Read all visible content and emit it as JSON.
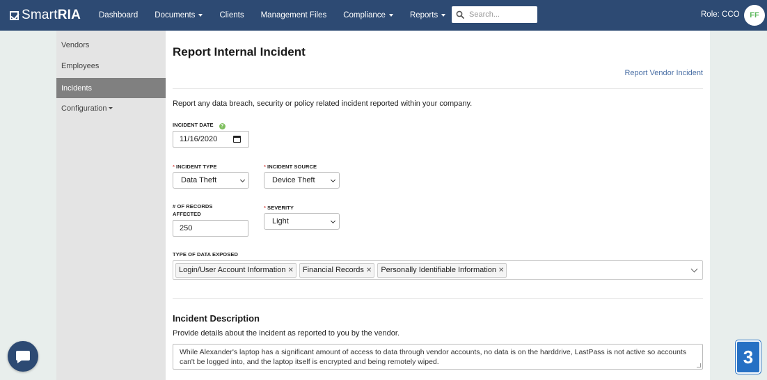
{
  "app": {
    "logo_text_light": "Smart",
    "logo_text_bold": "RIA"
  },
  "nav": {
    "items": [
      {
        "label": "Dashboard",
        "dropdown": false
      },
      {
        "label": "Documents",
        "dropdown": true
      },
      {
        "label": "Clients",
        "dropdown": false
      },
      {
        "label": "Management Files",
        "dropdown": false
      },
      {
        "label": "Compliance",
        "dropdown": true
      },
      {
        "label": "Reports",
        "dropdown": true
      }
    ],
    "search_placeholder": "Search...",
    "role": "Role: CCO",
    "avatar_initials": "FF"
  },
  "sidebar": {
    "items": [
      {
        "label": "Vendors"
      },
      {
        "label": "Employees"
      },
      {
        "label": "Incidents",
        "active": true
      },
      {
        "label": "Configuration",
        "dropdown": true
      }
    ]
  },
  "page": {
    "title": "Report Internal Incident",
    "vendor_link": "Report Vendor Incident",
    "intro": "Report any data breach, security or policy related incident reported within your company."
  },
  "form": {
    "incident_date": {
      "label": "Incident Date",
      "value": "11/16/2020"
    },
    "incident_type": {
      "label": "Incident Type",
      "value": "Data Theft",
      "required": true
    },
    "incident_source": {
      "label": "Incident Source",
      "value": "Device Theft",
      "required": true
    },
    "records_affected": {
      "label_line1": "# of Records",
      "label_line2": "Affected",
      "value": "250"
    },
    "severity": {
      "label": "Severity",
      "value": "Light",
      "required": true
    },
    "data_exposed": {
      "label": "Type of Data Exposed",
      "tags": [
        "Login/User Account Information",
        "Financial Records",
        "Personally Identifiable Information"
      ]
    },
    "description": {
      "heading": "Incident Description",
      "help": "Provide details about the incident as reported to you by the vendor.",
      "value": "While Alexander's laptop has a significant amount of access to data through vendor accounts, no data is on the harddrive, LastPass is not active so accounts can't be logged into, and the laptop itself is encrypted and being remotely wiped."
    }
  },
  "floating": {
    "badge_number": "3"
  },
  "colors": {
    "nav_bg": "#2d4a73",
    "sidebar_active": "#808080",
    "link": "#4a6fa5",
    "required": "#d9534f",
    "badge": "#2670c4"
  },
  "icons": [
    "check-logo-icon",
    "search-icon",
    "help-icon",
    "calendar-icon",
    "chevron-down-icon",
    "remove-tag-icon",
    "chat-icon"
  ]
}
